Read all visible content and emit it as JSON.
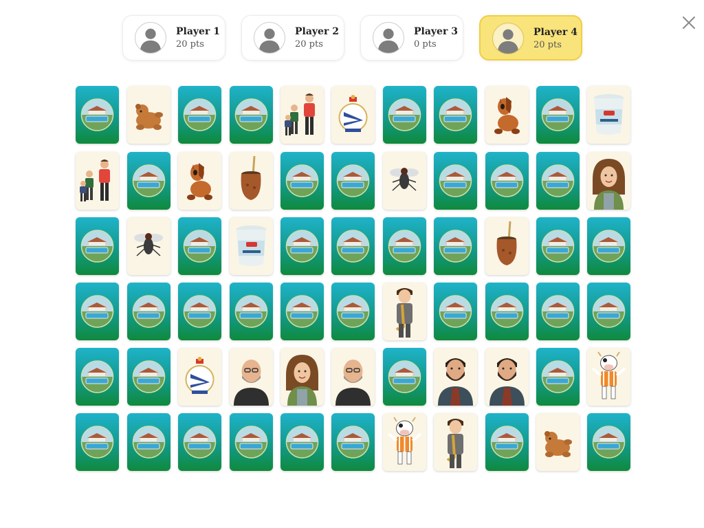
{
  "players": [
    {
      "name": "Player 1",
      "points": "20 pts",
      "active": false
    },
    {
      "name": "Player 2",
      "points": "20 pts",
      "active": false
    },
    {
      "name": "Player 3",
      "points": "0 pts",
      "active": false
    },
    {
      "name": "Player 4",
      "points": "20 pts",
      "active": true
    }
  ],
  "icons": {
    "avatar": "person-silhouette-icon",
    "close": "close-icon",
    "card_back": "house-with-pool-emblem"
  },
  "colors": {
    "active_player_bg": "#f9e47c",
    "active_player_border": "#f1cf3e",
    "card_back_top": "#1fb3c9",
    "card_back_bottom": "#0f8a3c",
    "card_face_bg": "#fbf5e6"
  },
  "board": {
    "rows": 6,
    "columns": 11,
    "cards": [
      [
        "back",
        "bear",
        "back",
        "back",
        "father-kids",
        "deportivo-crest",
        "back",
        "back",
        "pony",
        "back",
        "yogurt"
      ],
      [
        "father-kids",
        "back",
        "pony",
        "mate",
        "back",
        "back",
        "fly",
        "back",
        "back",
        "back",
        "woman"
      ],
      [
        "back",
        "fly",
        "back",
        "yogurt",
        "back",
        "back",
        "back",
        "back",
        "mate",
        "back",
        "back"
      ],
      [
        "back",
        "back",
        "back",
        "back",
        "back",
        "back",
        "saxophone-boy",
        "back",
        "back",
        "back",
        "back"
      ],
      [
        "back",
        "back",
        "deportivo-crest",
        "bald-man",
        "woman",
        "bald-man",
        "back",
        "bearded-man",
        "bearded-man",
        "back",
        "cow-mascot"
      ],
      [
        "back",
        "back",
        "back",
        "back",
        "back",
        "back",
        "cow-mascot",
        "saxophone-boy",
        "back",
        "bear",
        "back"
      ]
    ]
  }
}
